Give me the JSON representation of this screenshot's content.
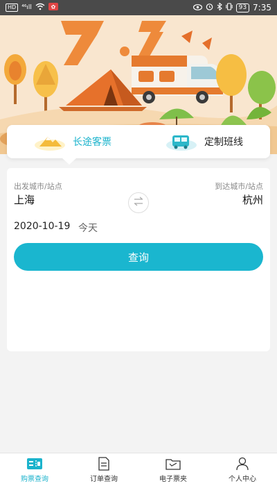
{
  "status_bar": {
    "hd": "HD",
    "signal": "⁴⁶ıll",
    "battery": "93",
    "time": "7:35"
  },
  "tabs": [
    {
      "label": "长途客票",
      "active": true
    },
    {
      "label": "定制班线",
      "active": false
    }
  ],
  "form": {
    "from_label": "出发城市/站点",
    "to_label": "到达城市/站点",
    "from_city": "上海",
    "to_city": "杭州",
    "date": "2020-10-19",
    "date_hint": "今天",
    "query_label": "查询"
  },
  "nav": [
    {
      "label": "购票查询",
      "icon": "ticket-icon",
      "active": true
    },
    {
      "label": "订单查询",
      "icon": "document-icon",
      "active": false
    },
    {
      "label": "电子票夹",
      "icon": "folder-icon",
      "active": false
    },
    {
      "label": "个人中心",
      "icon": "person-icon",
      "active": false
    }
  ],
  "colors": {
    "accent": "#1ab6cf",
    "banner_bg": "#f9e6cf"
  }
}
